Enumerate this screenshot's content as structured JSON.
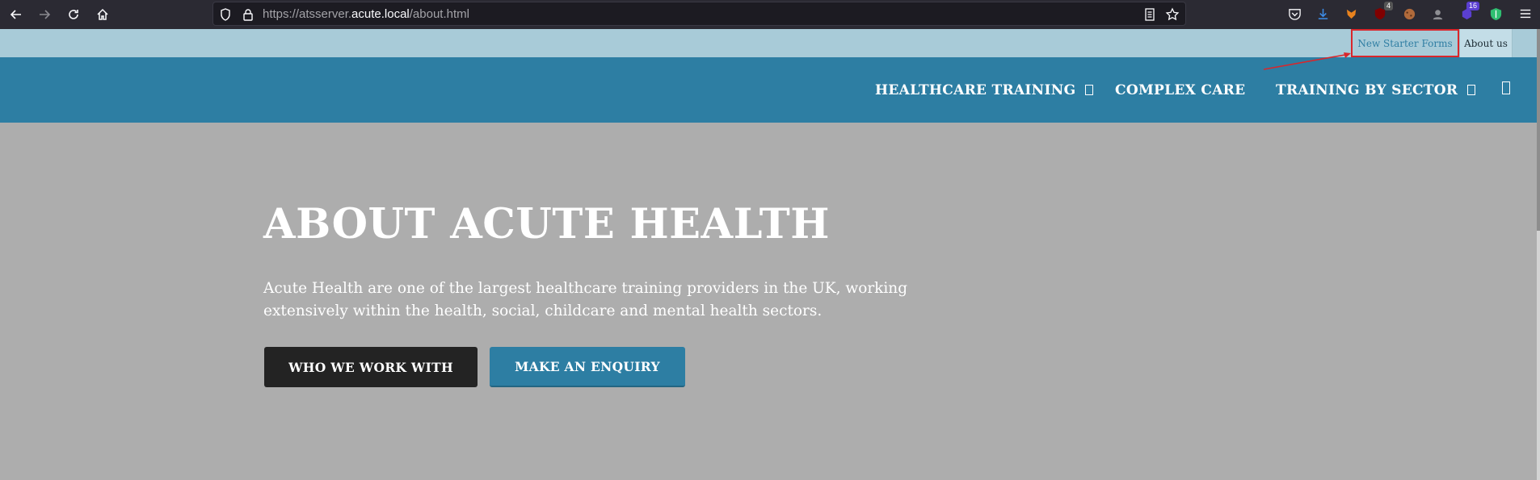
{
  "browser": {
    "url_prefix": "https://atsserver.",
    "url_domain": "acute.local",
    "url_path": "/about.html",
    "icons": [
      "back-icon",
      "forward-icon",
      "reload-icon",
      "home-icon",
      "shield-icon",
      "lock-icon",
      "reader-view-icon",
      "bookmark-star-icon",
      "pocket-icon",
      "downloads-icon",
      "extension-icons",
      "menu-icon"
    ],
    "ext_badges": {
      "ublock": "4",
      "ext_purple": "16"
    }
  },
  "utility_bar": {
    "new_starter": "New Starter Forms",
    "about_us": "About us"
  },
  "nav": {
    "items": [
      {
        "label": "HEALTHCARE TRAINING",
        "glyph": "00\n00"
      },
      {
        "label": "COMPLEX CARE"
      },
      {
        "label": "TRAINING BY SECTOR",
        "glyph": "00\n00"
      }
    ]
  },
  "hero": {
    "title": "ABOUT ACUTE HEALTH",
    "text": "Acute Health are one of the largest healthcare training providers in the UK, working extensively within the health, social, childcare and mental health sectors.",
    "btn_who": "WHO WE WORK WITH",
    "btn_enquiry": "MAKE AN ENQUIRY"
  },
  "colors": {
    "brand_blue": "#2d7ea3",
    "utility_bg": "#a8cbd8",
    "hero_bg": "#adadad",
    "annotation_red": "#d9262b"
  }
}
